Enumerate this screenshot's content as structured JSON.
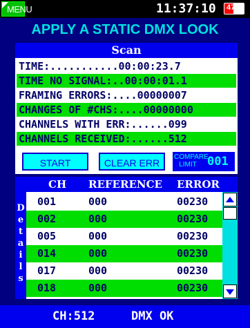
{
  "status_bar": {
    "menu_label": "MENU",
    "clock": "11:37:10",
    "battery_percent": 47,
    "battery_label": "47%"
  },
  "title": "APPLY A STATIC DMX LOOK",
  "scan": {
    "header": "Scan",
    "rows": [
      "TIME:...........00:00:23.7",
      "TIME NO SIGNAL:..00:00:01.1",
      "FRAMING ERRORS:....00000007",
      "CHANGES OF #CHS:....00000000",
      "CHANNELS WITH ERR:......099",
      "CHANNELS RECEIVED:......512"
    ],
    "start_label": "START",
    "clear_label": "CLEAR ERR",
    "compare_label": "COMPARE LIMIT",
    "compare_value": "001"
  },
  "details": {
    "side_label": "Details",
    "columns": [
      "CH",
      "REFERENCE",
      "ERROR"
    ],
    "rows": [
      [
        "001",
        "000",
        "00230"
      ],
      [
        "002",
        "000",
        "00230"
      ],
      [
        "005",
        "000",
        "00230"
      ],
      [
        "014",
        "000",
        "00230"
      ],
      [
        "017",
        "000",
        "00230"
      ],
      [
        "018",
        "000",
        "00230"
      ]
    ]
  },
  "footer": {
    "channel": "CH:512",
    "status": "DMX OK"
  },
  "icons": {
    "menu": "menu-arrow-icon",
    "up": "scroll-up-icon",
    "down": "scroll-down-icon"
  },
  "colors": {
    "background": "#000080",
    "accent": "#00e0e0",
    "highlight_row": "#00dd00",
    "header": "#0000ee"
  }
}
